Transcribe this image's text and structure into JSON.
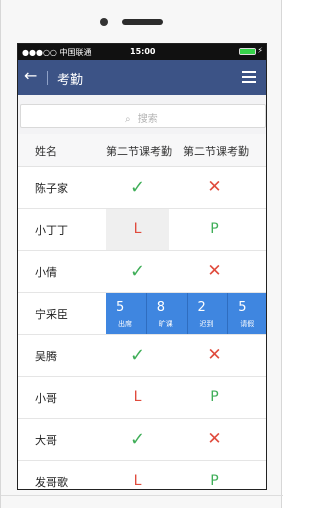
{
  "status_bar": {
    "carrier": "●●●○○ 中国联通",
    "time": "15:00"
  },
  "navbar": {
    "back_icon": "←",
    "title": "考勤",
    "menu_icon": "hamburger"
  },
  "search": {
    "placeholder": "搜索",
    "icon": "search-icon"
  },
  "table": {
    "headers": [
      "姓名",
      "第二节课考勤",
      "第二节课考勤"
    ],
    "rows": [
      {
        "name": "陈子家",
        "c1": "✓",
        "c2": "✕"
      },
      {
        "name": "小丁丁",
        "c1": "L",
        "c2": "P"
      },
      {
        "name": "小倩",
        "c1": "✓",
        "c2": "✕"
      },
      {
        "name": "宁采臣",
        "stats": [
          {
            "value": "5",
            "label": "出席"
          },
          {
            "value": "8",
            "label": "旷课"
          },
          {
            "value": "2",
            "label": "迟到"
          },
          {
            "value": "5",
            "label": "请假"
          }
        ]
      },
      {
        "name": "吴腾",
        "c1": "✓",
        "c2": "✕"
      },
      {
        "name": "小哥",
        "c1": "L",
        "c2": "P"
      },
      {
        "name": "大哥",
        "c1": "✓",
        "c2": "✕"
      },
      {
        "name": "发哥歌",
        "c1": "L",
        "c2": "P"
      }
    ]
  }
}
